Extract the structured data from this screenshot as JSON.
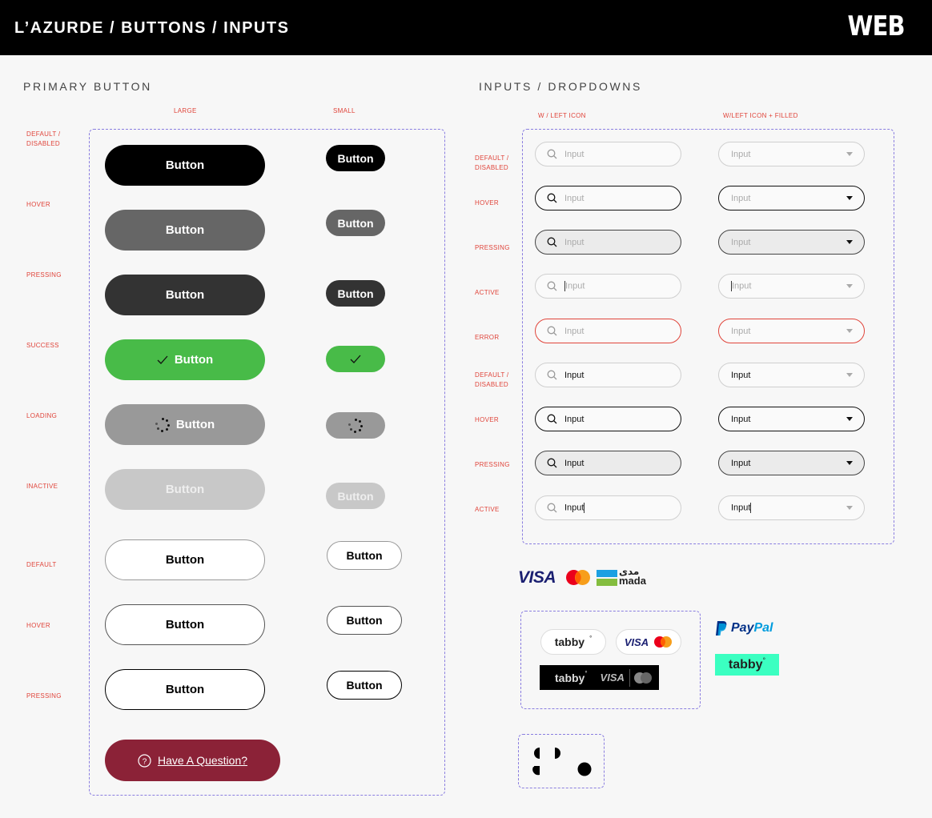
{
  "header": {
    "title": "L’AZURDE / BUTTONS / INPUTS",
    "platform": "WEB"
  },
  "primary": {
    "section_title": "PRIMARY BUTTON",
    "col_large": "LARGE",
    "col_small": "SMALL",
    "states": [
      "DEFAULT / DISABLED",
      "HOVER",
      "PRESSING",
      "SUCCESS",
      "LOADING",
      "INACTIVE",
      "DEFAULT",
      "HOVER",
      "PRESSING"
    ],
    "button_label": "Button",
    "question_label": "Have A Question?"
  },
  "inputs": {
    "section_title": "INPUTS / DROPDOWNS",
    "col_left_icon": "W / LEFT ICON",
    "col_filled": "W/LEFT ICON + FILLED",
    "states": [
      "DEFAULT / DISABLED",
      "HOVER",
      "PRESSING",
      "ACTIVE",
      "ERROR",
      "DEFAULT / DISABLED",
      "HOVER",
      "PRESSING",
      "ACTIVE"
    ],
    "placeholder": "Input",
    "value": "Input"
  },
  "payments": {
    "visa": "VISA",
    "mada_ar": "مدى",
    "mada": "mada",
    "tabby": "tabby",
    "paypal_pay": "Pay",
    "paypal_pal": "Pal"
  },
  "colors": {
    "accent_red": "#e0443a",
    "success": "#48bb48",
    "question": "#8b2237",
    "dash": "#8a7ee0",
    "tabby_green": "#3bffc1"
  }
}
